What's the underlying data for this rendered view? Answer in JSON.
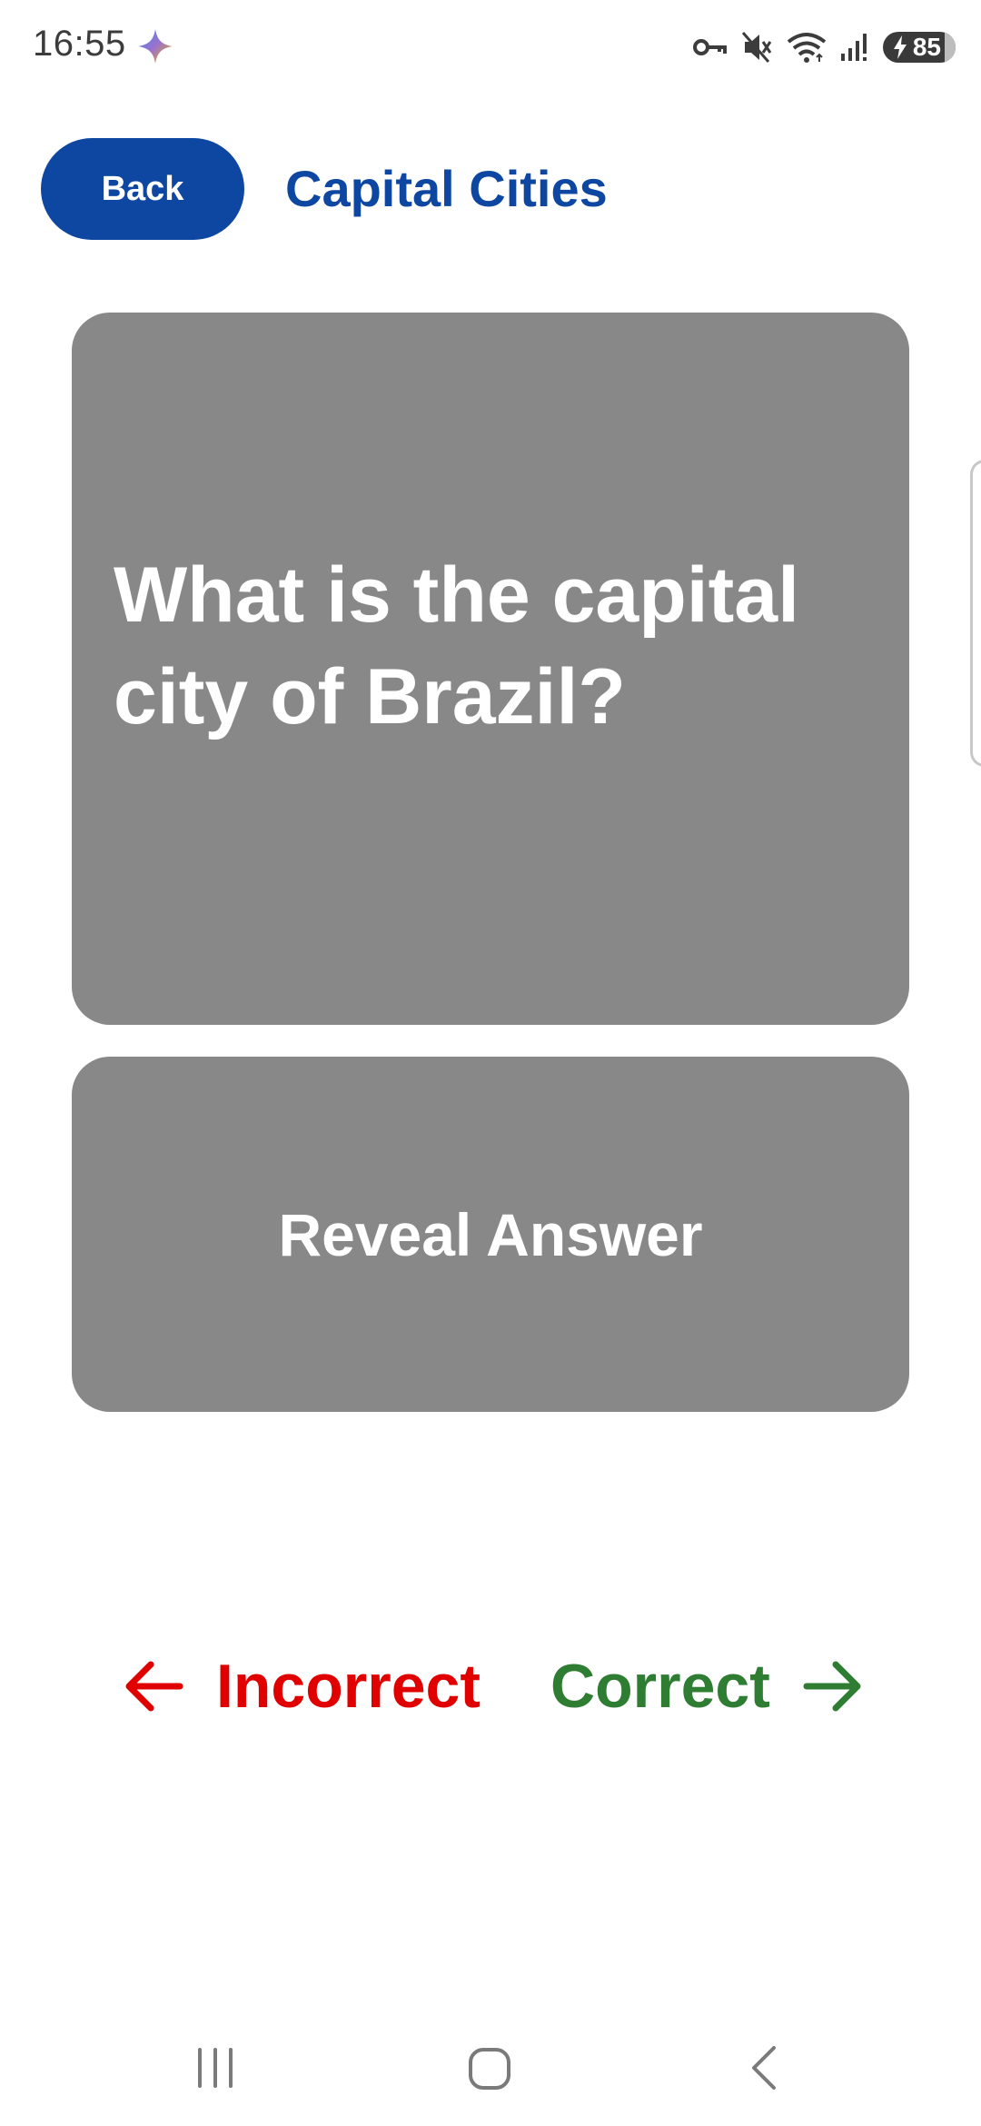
{
  "status_bar": {
    "time": "16:55",
    "battery_level": "85",
    "icons": [
      "sparkle-icon",
      "vpn-key-icon",
      "mute-icon",
      "wifi-icon",
      "signal-icon",
      "battery-icon"
    ]
  },
  "header": {
    "back_label": "Back",
    "title": "Capital Cities"
  },
  "card": {
    "question": "What is the capital city of Brazil?",
    "reveal_label": "Reveal Answer"
  },
  "swipe_hints": {
    "incorrect_label": "Incorrect",
    "correct_label": "Correct"
  },
  "colors": {
    "primary": "#0d47a1",
    "card": "#888888",
    "incorrect": "#e00000",
    "correct": "#2e7d32"
  },
  "nav_bar": {
    "icons": [
      "recents-icon",
      "home-icon",
      "back-icon"
    ]
  }
}
